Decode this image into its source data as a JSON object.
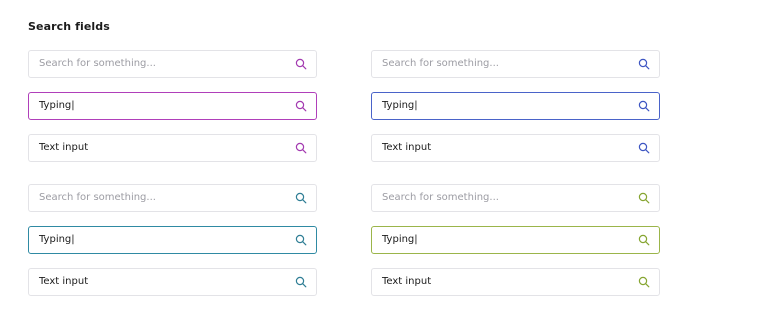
{
  "section": {
    "title": "Search fields"
  },
  "icon": "search-icon",
  "groups": [
    {
      "theme": "purple",
      "accent": "#a33ab0",
      "fields": [
        {
          "state": "empty",
          "placeholder": "Search for something..."
        },
        {
          "state": "focused",
          "value": "Typing|"
        },
        {
          "state": "filled",
          "value": "Text input"
        }
      ]
    },
    {
      "theme": "blue",
      "accent": "#3d55c2",
      "fields": [
        {
          "state": "empty",
          "placeholder": "Search for something..."
        },
        {
          "state": "focused",
          "value": "Typing|"
        },
        {
          "state": "filled",
          "value": "Text input"
        }
      ]
    },
    {
      "theme": "teal",
      "accent": "#2f7e95",
      "fields": [
        {
          "state": "empty",
          "placeholder": "Search for something..."
        },
        {
          "state": "focused",
          "value": "Typing|"
        },
        {
          "state": "filled",
          "value": "Text input"
        }
      ]
    },
    {
      "theme": "olive",
      "accent": "#86a531",
      "fields": [
        {
          "state": "empty",
          "placeholder": "Search for something..."
        },
        {
          "state": "focused",
          "value": "Typing|"
        },
        {
          "state": "filled",
          "value": "Text input"
        }
      ]
    }
  ]
}
